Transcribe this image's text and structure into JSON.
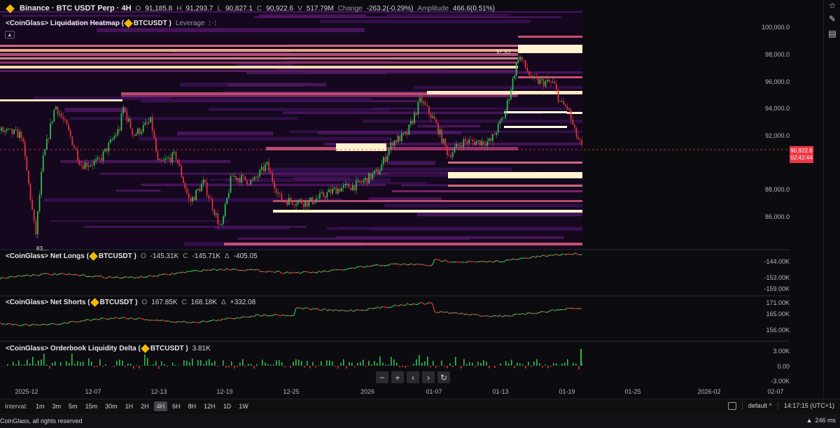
{
  "symbol_bar": {
    "title": "Binance · BTC USDT Perp · 4H",
    "open_label": "O",
    "open": "91,185.8",
    "high_label": "H",
    "high": "91,293.7",
    "low_label": "L",
    "low": "90,827.1",
    "close_label": "C",
    "close": "90,922.6",
    "volume_label": "V",
    "volume": "517.79M",
    "change_label": "Change",
    "change": "-263.2(-0.29%)",
    "amplitude_label": "Amplitude",
    "amplitude": "466.6(0.51%)"
  },
  "heatmap_legend": {
    "title": "<CoinGlass> Liquidation Heatmap (",
    "symbol": "BTCUSDT",
    "close": ")",
    "leverage_label": "Leverage"
  },
  "price_axis": {
    "ticks": [
      "100,000.0",
      "98,000.0",
      "96,000.0",
      "94,000.0",
      "92,000.0",
      "88,000.0",
      "86,000.0"
    ],
    "current_price": "90,922.6",
    "countdown": "02:42:44",
    "peak_label": "97,93...",
    "low_label": "83,..."
  },
  "net_longs": {
    "title": "<CoinGlass> Net Longs (",
    "symbol": "BTCUSDT",
    "close": ")",
    "o_label": "O",
    "o": "-145.31K",
    "c_label": "C",
    "c": "-145.71K",
    "delta_label": "Δ",
    "delta": "-405.05",
    "ticks": [
      "-144.00K",
      "-153.00K",
      "-159.00K"
    ]
  },
  "net_shorts": {
    "title": "<CoinGlass> Net Shorts (",
    "symbol": "BTCUSDT",
    "close": ")",
    "o_label": "O",
    "o": "167.85K",
    "c_label": "C",
    "c": "168.18K",
    "delta_label": "Δ",
    "delta": "+332.08",
    "ticks": [
      "171.00K",
      "165.00K",
      "156.00K"
    ]
  },
  "ob_delta": {
    "title": "<CoinGlass> Orderbook Liquidity Delta (",
    "symbol": "BTCUSDT",
    "close": ")",
    "value": "3.81K",
    "ticks": [
      "3.00K",
      "0.00",
      "-3.00K"
    ]
  },
  "time_axis": {
    "ticks": [
      "2025-12",
      "12-07",
      "12-13",
      "12-19",
      "12-25",
      "2026",
      "01-07",
      "01-13",
      "01-19",
      "01-25",
      "2026-02",
      "02-07"
    ]
  },
  "nav": {
    "zoom_out": "−",
    "zoom_in": "+",
    "scroll_left": "‹",
    "scroll_right": "›",
    "reset": "↻"
  },
  "interval_bar": {
    "label": "Interval:",
    "items": [
      "1m",
      "3m",
      "5m",
      "15m",
      "30m",
      "1H",
      "2H",
      "4H",
      "6H",
      "8H",
      "12H",
      "1D",
      "1W"
    ],
    "active": "4H",
    "layout": "default",
    "layout_arrow": "^",
    "clock": "14:17:15 (UTC+1)"
  },
  "footer": {
    "copyright": "CoinGlass, all rights reserved",
    "latency": "246 ms"
  },
  "colors": {
    "up": "#2ebd4f",
    "down": "#e0323c",
    "bg": "#0c0c10",
    "heat_low": "#3a1153",
    "heat_mid": "#b4436c",
    "heat_high": "#fff4cf"
  },
  "icons": [
    "star-icon",
    "edit-icon",
    "bookmark-icon",
    "signal-icon"
  ]
}
